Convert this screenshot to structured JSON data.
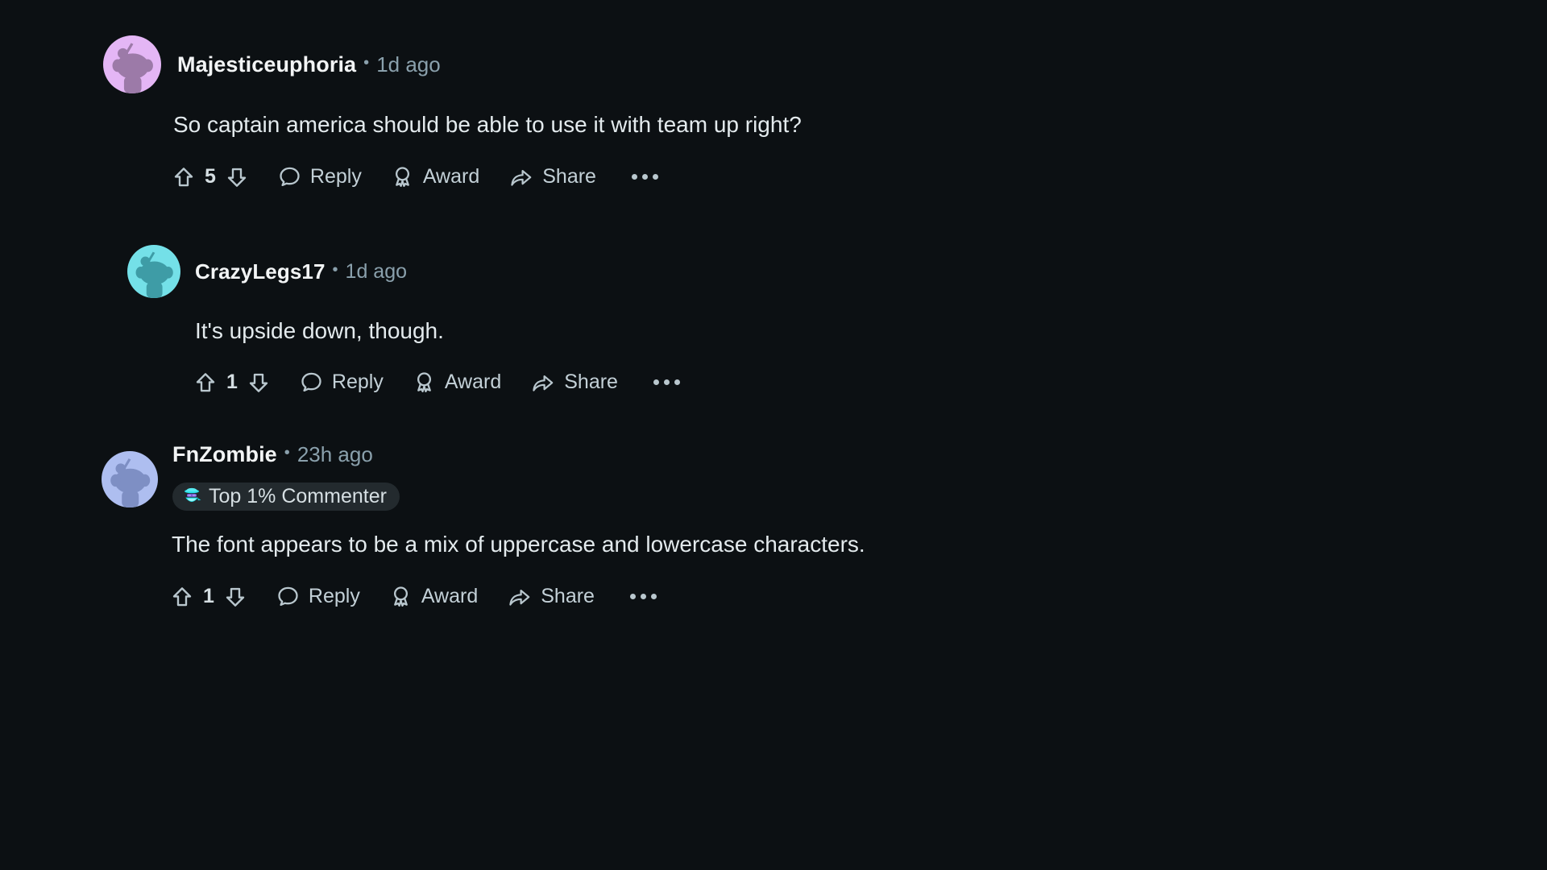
{
  "theme": {
    "background": "#0c1013",
    "username_color": "#f2f4f5",
    "meta_color": "#8aa0ac",
    "body_color": "#e3eaed",
    "action_color": "#c3d0d7",
    "badge_bg": "#232a2e"
  },
  "comments": [
    {
      "id": "comment-majesticeuphoria",
      "username": "Majesticeuphoria",
      "separator": "•",
      "timestamp": "1d ago",
      "avatar_color": "#e4b6f5",
      "avatar_snoo_color": "#9c7aa8",
      "body": "So captain america should be able to use it with team up right?",
      "score": "5",
      "badge": null,
      "actions": {
        "upvote": "upvote-icon",
        "downvote": "downvote-icon",
        "reply_label": "Reply",
        "award_label": "Award",
        "share_label": "Share",
        "more_label": "more-options-icon"
      }
    },
    {
      "id": "comment-crazylegs17",
      "username": "CrazyLegs17",
      "separator": "•",
      "timestamp": "1d ago",
      "avatar_color": "#74e0e8",
      "avatar_snoo_color": "#3e9ca6",
      "body": "It's upside down, though.",
      "score": "1",
      "badge": null,
      "actions": {
        "upvote": "upvote-icon",
        "downvote": "downvote-icon",
        "reply_label": "Reply",
        "award_label": "Award",
        "share_label": "Share",
        "more_label": "more-options-icon"
      }
    },
    {
      "id": "comment-fnzombie",
      "username": "FnZombie",
      "separator": "•",
      "timestamp": "23h ago",
      "avatar_color": "#aebef0",
      "avatar_snoo_color": "#7e8fc4",
      "body": "The font appears to be a mix of uppercase and lowercase characters.",
      "score": "1",
      "badge": {
        "label": "Top 1% Commenter",
        "icon": "ninja-commenter-icon"
      },
      "actions": {
        "upvote": "upvote-icon",
        "downvote": "downvote-icon",
        "reply_label": "Reply",
        "award_label": "Award",
        "share_label": "Share",
        "more_label": "more-options-icon"
      }
    }
  ]
}
